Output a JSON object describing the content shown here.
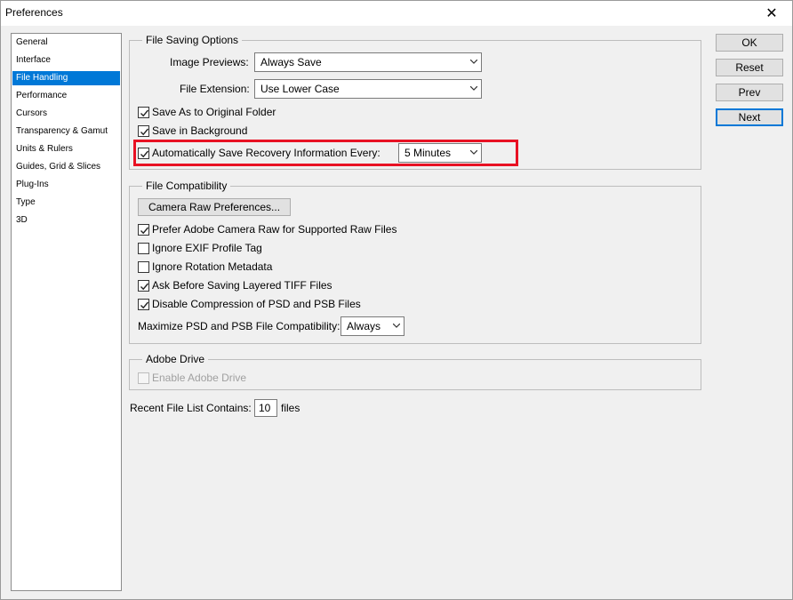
{
  "window": {
    "title": "Preferences",
    "close_symbol": "✕"
  },
  "sidebar": {
    "items": [
      {
        "label": "General"
      },
      {
        "label": "Interface"
      },
      {
        "label": "File Handling",
        "selected": true
      },
      {
        "label": "Performance"
      },
      {
        "label": "Cursors"
      },
      {
        "label": "Transparency & Gamut"
      },
      {
        "label": "Units & Rulers"
      },
      {
        "label": "Guides, Grid & Slices"
      },
      {
        "label": "Plug-Ins"
      },
      {
        "label": "Type"
      },
      {
        "label": "3D"
      }
    ]
  },
  "file_saving": {
    "legend": "File Saving Options",
    "image_previews_label": "Image Previews:",
    "image_previews_value": "Always Save",
    "file_extension_label": "File Extension:",
    "file_extension_value": "Use Lower Case",
    "save_as_original_label": "Save As to Original Folder",
    "save_as_original_checked": true,
    "save_in_background_label": "Save in Background",
    "save_in_background_checked": true,
    "auto_save_label": "Automatically Save Recovery Information Every:",
    "auto_save_checked": true,
    "auto_save_interval_value": "5 Minutes"
  },
  "file_compat": {
    "legend": "File Compatibility",
    "camera_raw_button": "Camera Raw Preferences...",
    "prefer_camera_raw_label": "Prefer Adobe Camera Raw for Supported Raw Files",
    "prefer_camera_raw_checked": true,
    "ignore_exif_label": "Ignore EXIF Profile Tag",
    "ignore_exif_checked": false,
    "ignore_rotation_label": "Ignore Rotation Metadata",
    "ignore_rotation_checked": false,
    "ask_tiff_label": "Ask Before Saving Layered TIFF Files",
    "ask_tiff_checked": true,
    "disable_compression_label": "Disable Compression of PSD and PSB Files",
    "disable_compression_checked": true,
    "maximize_label": "Maximize PSD and PSB File Compatibility:",
    "maximize_value": "Always"
  },
  "adobe_drive": {
    "legend": "Adobe Drive",
    "enable_label": "Enable Adobe Drive",
    "enable_checked": false
  },
  "recent_files": {
    "label": "Recent File List Contains:",
    "value": "10",
    "suffix": "files"
  },
  "buttons": {
    "ok": "OK",
    "reset": "Reset",
    "prev": "Prev",
    "next": "Next"
  },
  "colors": {
    "selection": "#0078d7",
    "highlight_border": "#e81123",
    "background": "#f0f0f0"
  }
}
